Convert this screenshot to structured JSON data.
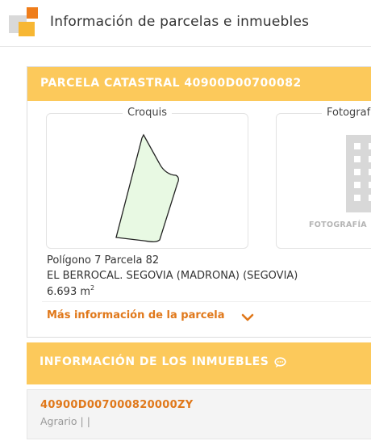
{
  "header": {
    "title": "Información de parcelas e inmuebles"
  },
  "parcela": {
    "heading": "PARCELA CATASTRAL 40900D00700082",
    "croquis_label": "Croquis",
    "foto_label": "Fotografía",
    "foto_placeholder": "FOTOGRAFÍA",
    "poligono": "Polígono 7 Parcela 82",
    "localidad": "EL BERROCAL. SEGOVIA (MADRONA) (SEGOVIA)",
    "superficie": "6.693 m",
    "superficie_exp": "2",
    "more_link": "Más información de la parcela"
  },
  "inmuebles": {
    "heading": "INFORMACIÓN DE LOS INMUEBLES",
    "items": [
      {
        "ref": "40900D007000820000ZY",
        "detail": "Agrario | |"
      }
    ]
  },
  "colors": {
    "accent": "#fcc95b",
    "link": "#e0781a",
    "parcel_fill": "#e8f9e3"
  }
}
